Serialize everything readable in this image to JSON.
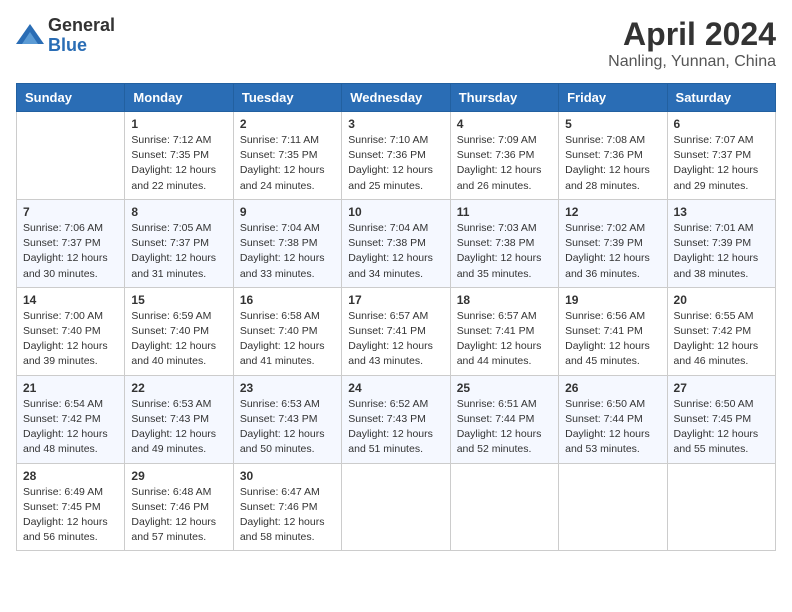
{
  "header": {
    "logo_general": "General",
    "logo_blue": "Blue",
    "title": "April 2024",
    "subtitle": "Nanling, Yunnan, China"
  },
  "days_of_week": [
    "Sunday",
    "Monday",
    "Tuesday",
    "Wednesday",
    "Thursday",
    "Friday",
    "Saturday"
  ],
  "weeks": [
    [
      {
        "day": "",
        "sunrise": "",
        "sunset": "",
        "daylight": ""
      },
      {
        "day": "1",
        "sunrise": "Sunrise: 7:12 AM",
        "sunset": "Sunset: 7:35 PM",
        "daylight": "Daylight: 12 hours and 22 minutes."
      },
      {
        "day": "2",
        "sunrise": "Sunrise: 7:11 AM",
        "sunset": "Sunset: 7:35 PM",
        "daylight": "Daylight: 12 hours and 24 minutes."
      },
      {
        "day": "3",
        "sunrise": "Sunrise: 7:10 AM",
        "sunset": "Sunset: 7:36 PM",
        "daylight": "Daylight: 12 hours and 25 minutes."
      },
      {
        "day": "4",
        "sunrise": "Sunrise: 7:09 AM",
        "sunset": "Sunset: 7:36 PM",
        "daylight": "Daylight: 12 hours and 26 minutes."
      },
      {
        "day": "5",
        "sunrise": "Sunrise: 7:08 AM",
        "sunset": "Sunset: 7:36 PM",
        "daylight": "Daylight: 12 hours and 28 minutes."
      },
      {
        "day": "6",
        "sunrise": "Sunrise: 7:07 AM",
        "sunset": "Sunset: 7:37 PM",
        "daylight": "Daylight: 12 hours and 29 minutes."
      }
    ],
    [
      {
        "day": "7",
        "sunrise": "Sunrise: 7:06 AM",
        "sunset": "Sunset: 7:37 PM",
        "daylight": "Daylight: 12 hours and 30 minutes."
      },
      {
        "day": "8",
        "sunrise": "Sunrise: 7:05 AM",
        "sunset": "Sunset: 7:37 PM",
        "daylight": "Daylight: 12 hours and 31 minutes."
      },
      {
        "day": "9",
        "sunrise": "Sunrise: 7:04 AM",
        "sunset": "Sunset: 7:38 PM",
        "daylight": "Daylight: 12 hours and 33 minutes."
      },
      {
        "day": "10",
        "sunrise": "Sunrise: 7:04 AM",
        "sunset": "Sunset: 7:38 PM",
        "daylight": "Daylight: 12 hours and 34 minutes."
      },
      {
        "day": "11",
        "sunrise": "Sunrise: 7:03 AM",
        "sunset": "Sunset: 7:38 PM",
        "daylight": "Daylight: 12 hours and 35 minutes."
      },
      {
        "day": "12",
        "sunrise": "Sunrise: 7:02 AM",
        "sunset": "Sunset: 7:39 PM",
        "daylight": "Daylight: 12 hours and 36 minutes."
      },
      {
        "day": "13",
        "sunrise": "Sunrise: 7:01 AM",
        "sunset": "Sunset: 7:39 PM",
        "daylight": "Daylight: 12 hours and 38 minutes."
      }
    ],
    [
      {
        "day": "14",
        "sunrise": "Sunrise: 7:00 AM",
        "sunset": "Sunset: 7:40 PM",
        "daylight": "Daylight: 12 hours and 39 minutes."
      },
      {
        "day": "15",
        "sunrise": "Sunrise: 6:59 AM",
        "sunset": "Sunset: 7:40 PM",
        "daylight": "Daylight: 12 hours and 40 minutes."
      },
      {
        "day": "16",
        "sunrise": "Sunrise: 6:58 AM",
        "sunset": "Sunset: 7:40 PM",
        "daylight": "Daylight: 12 hours and 41 minutes."
      },
      {
        "day": "17",
        "sunrise": "Sunrise: 6:57 AM",
        "sunset": "Sunset: 7:41 PM",
        "daylight": "Daylight: 12 hours and 43 minutes."
      },
      {
        "day": "18",
        "sunrise": "Sunrise: 6:57 AM",
        "sunset": "Sunset: 7:41 PM",
        "daylight": "Daylight: 12 hours and 44 minutes."
      },
      {
        "day": "19",
        "sunrise": "Sunrise: 6:56 AM",
        "sunset": "Sunset: 7:41 PM",
        "daylight": "Daylight: 12 hours and 45 minutes."
      },
      {
        "day": "20",
        "sunrise": "Sunrise: 6:55 AM",
        "sunset": "Sunset: 7:42 PM",
        "daylight": "Daylight: 12 hours and 46 minutes."
      }
    ],
    [
      {
        "day": "21",
        "sunrise": "Sunrise: 6:54 AM",
        "sunset": "Sunset: 7:42 PM",
        "daylight": "Daylight: 12 hours and 48 minutes."
      },
      {
        "day": "22",
        "sunrise": "Sunrise: 6:53 AM",
        "sunset": "Sunset: 7:43 PM",
        "daylight": "Daylight: 12 hours and 49 minutes."
      },
      {
        "day": "23",
        "sunrise": "Sunrise: 6:53 AM",
        "sunset": "Sunset: 7:43 PM",
        "daylight": "Daylight: 12 hours and 50 minutes."
      },
      {
        "day": "24",
        "sunrise": "Sunrise: 6:52 AM",
        "sunset": "Sunset: 7:43 PM",
        "daylight": "Daylight: 12 hours and 51 minutes."
      },
      {
        "day": "25",
        "sunrise": "Sunrise: 6:51 AM",
        "sunset": "Sunset: 7:44 PM",
        "daylight": "Daylight: 12 hours and 52 minutes."
      },
      {
        "day": "26",
        "sunrise": "Sunrise: 6:50 AM",
        "sunset": "Sunset: 7:44 PM",
        "daylight": "Daylight: 12 hours and 53 minutes."
      },
      {
        "day": "27",
        "sunrise": "Sunrise: 6:50 AM",
        "sunset": "Sunset: 7:45 PM",
        "daylight": "Daylight: 12 hours and 55 minutes."
      }
    ],
    [
      {
        "day": "28",
        "sunrise": "Sunrise: 6:49 AM",
        "sunset": "Sunset: 7:45 PM",
        "daylight": "Daylight: 12 hours and 56 minutes."
      },
      {
        "day": "29",
        "sunrise": "Sunrise: 6:48 AM",
        "sunset": "Sunset: 7:46 PM",
        "daylight": "Daylight: 12 hours and 57 minutes."
      },
      {
        "day": "30",
        "sunrise": "Sunrise: 6:47 AM",
        "sunset": "Sunset: 7:46 PM",
        "daylight": "Daylight: 12 hours and 58 minutes."
      },
      {
        "day": "",
        "sunrise": "",
        "sunset": "",
        "daylight": ""
      },
      {
        "day": "",
        "sunrise": "",
        "sunset": "",
        "daylight": ""
      },
      {
        "day": "",
        "sunrise": "",
        "sunset": "",
        "daylight": ""
      },
      {
        "day": "",
        "sunrise": "",
        "sunset": "",
        "daylight": ""
      }
    ]
  ]
}
